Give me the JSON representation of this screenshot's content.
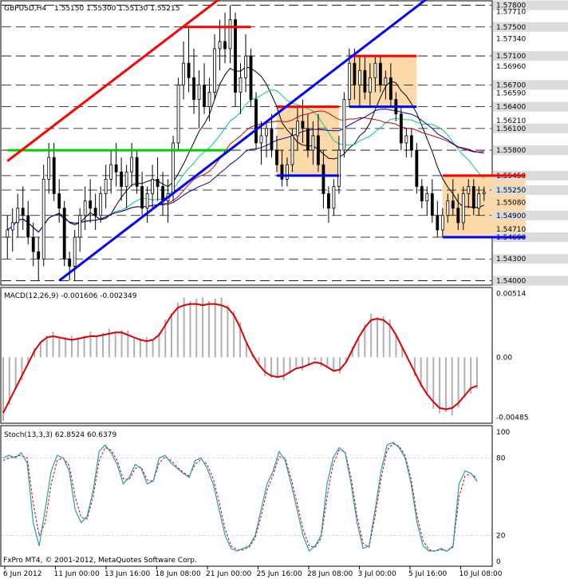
{
  "header": {
    "symbol_label": "GBPUSD,H4",
    "ohlc_label": "1.55150 1.55300 1.55130 1.55215"
  },
  "copyright": "FxPro MT4, © 2001-2012, MetaQuotes Software Corp.",
  "colors": {
    "candle": "#000000",
    "trend_red": "#ff0000",
    "trend_blue": "#0000ff",
    "support_green": "#00cc00",
    "range_box": "#fbd9a9",
    "ma_fast": "#000000",
    "ma_mid": "#00cc88",
    "ma_slow_red": "#cc0000",
    "ma_slow_blue": "#0000aa",
    "macd_line": "#dd0000",
    "macd_hist": "#b0b0b0",
    "stoch_main": "#20a0b0",
    "stoch_signal": "#dd0000",
    "highlight_label_bg": "#dcdcdc"
  },
  "chart_data": [
    {
      "type": "candlestick",
      "panel": "price",
      "y_ticks": [
        {
          "label": "1.57800",
          "value": 1.578,
          "highlight": true
        },
        {
          "label": "1.57710",
          "value": 1.5771,
          "highlight": false
        },
        {
          "label": "1.57500",
          "value": 1.575,
          "highlight": true
        },
        {
          "label": "1.57340",
          "value": 1.5734,
          "highlight": false
        },
        {
          "label": "1.57100",
          "value": 1.571,
          "highlight": true
        },
        {
          "label": "1.56960",
          "value": 1.5696,
          "highlight": false
        },
        {
          "label": "1.56700",
          "value": 1.567,
          "highlight": true
        },
        {
          "label": "1.56590",
          "value": 1.5659,
          "highlight": false
        },
        {
          "label": "1.56400",
          "value": 1.564,
          "highlight": true
        },
        {
          "label": "1.56210",
          "value": 1.5621,
          "highlight": false
        },
        {
          "label": "1.56100",
          "value": 1.561,
          "highlight": true
        },
        {
          "label": "1.55800",
          "value": 1.558,
          "highlight": true
        },
        {
          "label": "1.55450",
          "value": 1.5545,
          "highlight": true
        },
        {
          "label": "1.55250",
          "value": 1.5525,
          "highlight": true
        },
        {
          "label": "1.55080",
          "value": 1.5508,
          "highlight": false
        },
        {
          "label": "1.54900",
          "value": 1.549,
          "highlight": true
        },
        {
          "label": "1.54710",
          "value": 1.5471,
          "highlight": false
        },
        {
          "label": "1.54600",
          "value": 1.546,
          "highlight": true
        },
        {
          "label": "1.54300",
          "value": 1.543,
          "highlight": true
        },
        {
          "label": "1.54000",
          "value": 1.54,
          "highlight": true
        }
      ],
      "dashed_levels": [
        1.578,
        1.575,
        1.571,
        1.567,
        1.564,
        1.561,
        1.558,
        1.5545,
        1.5525,
        1.549,
        1.546,
        1.543,
        1.54
      ],
      "x_labels": [
        "6 Jun 2012",
        "11 Jun 00:00",
        "13 Jun 16:00",
        "18 Jun 08:00",
        "21 Jun 00:00",
        "25 Jun 16:00",
        "28 Jun 08:00",
        "3 Jul 00:00",
        "5 Jul 16:00",
        "10 Jul 08:00"
      ],
      "ohlc": [
        [
          1.546,
          1.549,
          1.543,
          1.547
        ],
        [
          1.547,
          1.55,
          1.544,
          1.548
        ],
        [
          1.548,
          1.552,
          1.546,
          1.55
        ],
        [
          1.55,
          1.553,
          1.547,
          1.549
        ],
        [
          1.549,
          1.551,
          1.545,
          1.546
        ],
        [
          1.546,
          1.548,
          1.542,
          1.544
        ],
        [
          1.544,
          1.546,
          1.54,
          1.543
        ],
        [
          1.543,
          1.556,
          1.542,
          1.554
        ],
        [
          1.554,
          1.559,
          1.552,
          1.557
        ],
        [
          1.557,
          1.559,
          1.551,
          1.552
        ],
        [
          1.552,
          1.554,
          1.548,
          1.55
        ],
        [
          1.55,
          1.551,
          1.542,
          1.543
        ],
        [
          1.543,
          1.544,
          1.54,
          1.542
        ],
        [
          1.542,
          1.547,
          1.54,
          1.546
        ],
        [
          1.546,
          1.55,
          1.544,
          1.549
        ],
        [
          1.549,
          1.553,
          1.547,
          1.551
        ],
        [
          1.551,
          1.554,
          1.548,
          1.55
        ],
        [
          1.55,
          1.552,
          1.547,
          1.549
        ],
        [
          1.549,
          1.553,
          1.548,
          1.552
        ],
        [
          1.552,
          1.556,
          1.55,
          1.554
        ],
        [
          1.554,
          1.558,
          1.552,
          1.556
        ],
        [
          1.556,
          1.559,
          1.553,
          1.555
        ],
        [
          1.555,
          1.557,
          1.551,
          1.553
        ],
        [
          1.553,
          1.556,
          1.55,
          1.555
        ],
        [
          1.555,
          1.559,
          1.553,
          1.557
        ],
        [
          1.557,
          1.558,
          1.552,
          1.553
        ],
        [
          1.553,
          1.555,
          1.549,
          1.55
        ],
        [
          1.55,
          1.553,
          1.548,
          1.552
        ],
        [
          1.552,
          1.556,
          1.55,
          1.554
        ],
        [
          1.554,
          1.557,
          1.551,
          1.553
        ],
        [
          1.553,
          1.555,
          1.549,
          1.551
        ],
        [
          1.551,
          1.554,
          1.548,
          1.552
        ],
        [
          1.552,
          1.56,
          1.551,
          1.559
        ],
        [
          1.559,
          1.568,
          1.558,
          1.567
        ],
        [
          1.567,
          1.573,
          1.565,
          1.57
        ],
        [
          1.57,
          1.575,
          1.566,
          1.568
        ],
        [
          1.568,
          1.572,
          1.563,
          1.565
        ],
        [
          1.565,
          1.569,
          1.561,
          1.567
        ],
        [
          1.567,
          1.57,
          1.563,
          1.564
        ],
        [
          1.564,
          1.568,
          1.562,
          1.566
        ],
        [
          1.566,
          1.574,
          1.565,
          1.572
        ],
        [
          1.572,
          1.576,
          1.569,
          1.573
        ],
        [
          1.573,
          1.577,
          1.57,
          1.572
        ],
        [
          1.572,
          1.578,
          1.57,
          1.576
        ],
        [
          1.576,
          1.577,
          1.564,
          1.566
        ],
        [
          1.566,
          1.57,
          1.563,
          1.568
        ],
        [
          1.568,
          1.574,
          1.566,
          1.571
        ],
        [
          1.571,
          1.572,
          1.564,
          1.565
        ],
        [
          1.565,
          1.566,
          1.558,
          1.559
        ],
        [
          1.559,
          1.562,
          1.556,
          1.56
        ],
        [
          1.56,
          1.562,
          1.557,
          1.561
        ],
        [
          1.561,
          1.563,
          1.557,
          1.558
        ],
        [
          1.558,
          1.56,
          1.555,
          1.556
        ],
        [
          1.556,
          1.558,
          1.553,
          1.554
        ],
        [
          1.554,
          1.557,
          1.553,
          1.556
        ],
        [
          1.556,
          1.561,
          1.555,
          1.56
        ],
        [
          1.56,
          1.564,
          1.558,
          1.562
        ],
        [
          1.562,
          1.565,
          1.559,
          1.561
        ],
        [
          1.561,
          1.563,
          1.557,
          1.558
        ],
        [
          1.558,
          1.562,
          1.556,
          1.56
        ],
        [
          1.56,
          1.563,
          1.555,
          1.556
        ],
        [
          1.556,
          1.558,
          1.55,
          1.552
        ],
        [
          1.552,
          1.553,
          1.548,
          1.55
        ],
        [
          1.55,
          1.554,
          1.549,
          1.553
        ],
        [
          1.553,
          1.56,
          1.552,
          1.558
        ],
        [
          1.558,
          1.566,
          1.557,
          1.565
        ],
        [
          1.565,
          1.572,
          1.564,
          1.57
        ],
        [
          1.57,
          1.572,
          1.565,
          1.567
        ],
        [
          1.567,
          1.571,
          1.564,
          1.569
        ],
        [
          1.569,
          1.571,
          1.565,
          1.566
        ],
        [
          1.566,
          1.57,
          1.564,
          1.568
        ],
        [
          1.568,
          1.571,
          1.566,
          1.57
        ],
        [
          1.57,
          1.571,
          1.566,
          1.567
        ],
        [
          1.567,
          1.569,
          1.565,
          1.568
        ],
        [
          1.568,
          1.57,
          1.564,
          1.565
        ],
        [
          1.565,
          1.566,
          1.562,
          1.563
        ],
        [
          1.563,
          1.564,
          1.558,
          1.559
        ],
        [
          1.559,
          1.561,
          1.557,
          1.56
        ],
        [
          1.56,
          1.561,
          1.557,
          1.558
        ],
        [
          1.558,
          1.559,
          1.552,
          1.553
        ],
        [
          1.553,
          1.554,
          1.55,
          1.551
        ],
        [
          1.551,
          1.553,
          1.549,
          1.552
        ],
        [
          1.552,
          1.554,
          1.548,
          1.549
        ],
        [
          1.549,
          1.551,
          1.546,
          1.547
        ],
        [
          1.547,
          1.55,
          1.546,
          1.549
        ],
        [
          1.549,
          1.552,
          1.548,
          1.551
        ],
        [
          1.551,
          1.554,
          1.549,
          1.55
        ],
        [
          1.55,
          1.552,
          1.547,
          1.548
        ],
        [
          1.548,
          1.553,
          1.547,
          1.552
        ],
        [
          1.552,
          1.554,
          1.55,
          1.553
        ],
        [
          1.553,
          1.554,
          1.549,
          1.55
        ],
        [
          1.55,
          1.553,
          1.549,
          1.552
        ],
        [
          1.552,
          1.553,
          1.551,
          1.5522
        ]
      ],
      "trend_lines": [
        {
          "color": "red",
          "from": [
            0,
            1.5565
          ],
          "to": [
            43,
            1.58
          ]
        },
        {
          "color": "blue",
          "from": [
            10,
            1.54
          ],
          "to": [
            83,
            1.58
          ]
        }
      ],
      "level_segments": [
        {
          "color": "red",
          "value": 1.575,
          "from": 34,
          "to": 47
        },
        {
          "color": "red",
          "value": 1.564,
          "from": 52,
          "to": 64
        },
        {
          "color": "blue",
          "value": 1.5545,
          "from": 52,
          "to": 64
        },
        {
          "color": "red",
          "value": 1.571,
          "from": 66,
          "to": 79
        },
        {
          "color": "blue",
          "value": 1.564,
          "from": 66,
          "to": 79
        },
        {
          "color": "red",
          "value": 1.5545,
          "from": 84,
          "to": 100
        },
        {
          "color": "blue",
          "value": 1.546,
          "from": 84,
          "to": 100
        },
        {
          "color": "green",
          "value": 1.558,
          "from": 0,
          "to": 43
        }
      ],
      "range_boxes": [
        {
          "from": 52,
          "to": 64,
          "top": 1.564,
          "bottom": 1.5545
        },
        {
          "from": 66,
          "to": 79,
          "top": 1.571,
          "bottom": 1.564
        },
        {
          "from": 84,
          "to": 100,
          "top": 1.5545,
          "bottom": 1.546
        }
      ]
    },
    {
      "type": "macd",
      "panel": "macd",
      "label": "MACD(12,26,9) -0.001606 -0.002349",
      "y_ticks": [
        {
          "label": "0.00514",
          "value": 0.00514
        },
        {
          "label": "0.00",
          "value": 0
        },
        {
          "label": "-0.00485",
          "value": -0.00485
        }
      ],
      "signal": [
        -0.0045,
        -0.0035,
        -0.0025,
        -0.0015,
        -0.0005,
        0.0005,
        0.0012,
        0.0016,
        0.0017,
        0.0016,
        0.0015,
        0.0014,
        0.0015,
        0.0016,
        0.0017,
        0.0017,
        0.0018,
        0.0019,
        0.002,
        0.002,
        0.0018,
        0.0016,
        0.0014,
        0.0013,
        0.0014,
        0.0018,
        0.0026,
        0.0034,
        0.004,
        0.0042,
        0.0043,
        0.0043,
        0.0042,
        0.0043,
        0.0043,
        0.0042,
        0.004,
        0.0034,
        0.0024,
        0.0012,
        0.0002,
        -0.0006,
        -0.0012,
        -0.0015,
        -0.0016,
        -0.0015,
        -0.0012,
        -0.0009,
        -0.0008,
        -0.0006,
        -0.0004,
        -0.0005,
        -0.0008,
        -0.0011,
        -0.001,
        -0.0004,
        0.0006,
        0.0016,
        0.0024,
        0.003,
        0.0031,
        0.003,
        0.0026,
        0.0018,
        0.0008,
        -0.0002,
        -0.0012,
        -0.0022,
        -0.003,
        -0.0036,
        -0.0041,
        -0.0042,
        -0.0041,
        -0.0037,
        -0.0031,
        -0.0025,
        -0.0023
      ]
    },
    {
      "type": "stochastic",
      "panel": "stoch",
      "label": "Stoch(13,3,3) 62.8524 60.6379",
      "y_ticks": [
        {
          "label": "100",
          "value": 100
        },
        {
          "label": "80",
          "value": 80
        },
        {
          "label": "20",
          "value": 20
        },
        {
          "label": "0",
          "value": 0
        }
      ],
      "main": [
        80,
        82,
        80,
        84,
        76,
        30,
        12,
        40,
        70,
        82,
        80,
        70,
        40,
        30,
        35,
        55,
        85,
        90,
        84,
        75,
        60,
        65,
        75,
        72,
        60,
        62,
        80,
        82,
        76,
        72,
        68,
        65,
        78,
        80,
        72,
        60,
        40,
        20,
        10,
        8,
        10,
        12,
        20,
        40,
        60,
        70,
        85,
        78,
        60,
        40,
        20,
        8,
        12,
        20,
        60,
        80,
        88,
        84,
        60,
        30,
        10,
        12,
        40,
        70,
        90,
        92,
        88,
        80,
        60,
        30,
        12,
        8,
        8,
        10,
        8,
        12,
        60,
        70,
        68,
        62
      ],
      "signal": [
        78,
        80,
        81,
        82,
        80,
        45,
        20,
        30,
        60,
        78,
        80,
        74,
        50,
        34,
        33,
        50,
        78,
        88,
        86,
        78,
        64,
        63,
        72,
        73,
        63,
        62,
        76,
        81,
        78,
        73,
        69,
        66,
        75,
        79,
        75,
        64,
        46,
        25,
        12,
        9,
        9,
        11,
        18,
        35,
        55,
        67,
        81,
        80,
        64,
        45,
        25,
        12,
        11,
        18,
        50,
        75,
        86,
        85,
        65,
        35,
        14,
        11,
        35,
        64,
        86,
        91,
        89,
        82,
        64,
        35,
        16,
        9,
        8,
        9,
        8,
        11,
        50,
        66,
        68,
        64
      ]
    }
  ]
}
